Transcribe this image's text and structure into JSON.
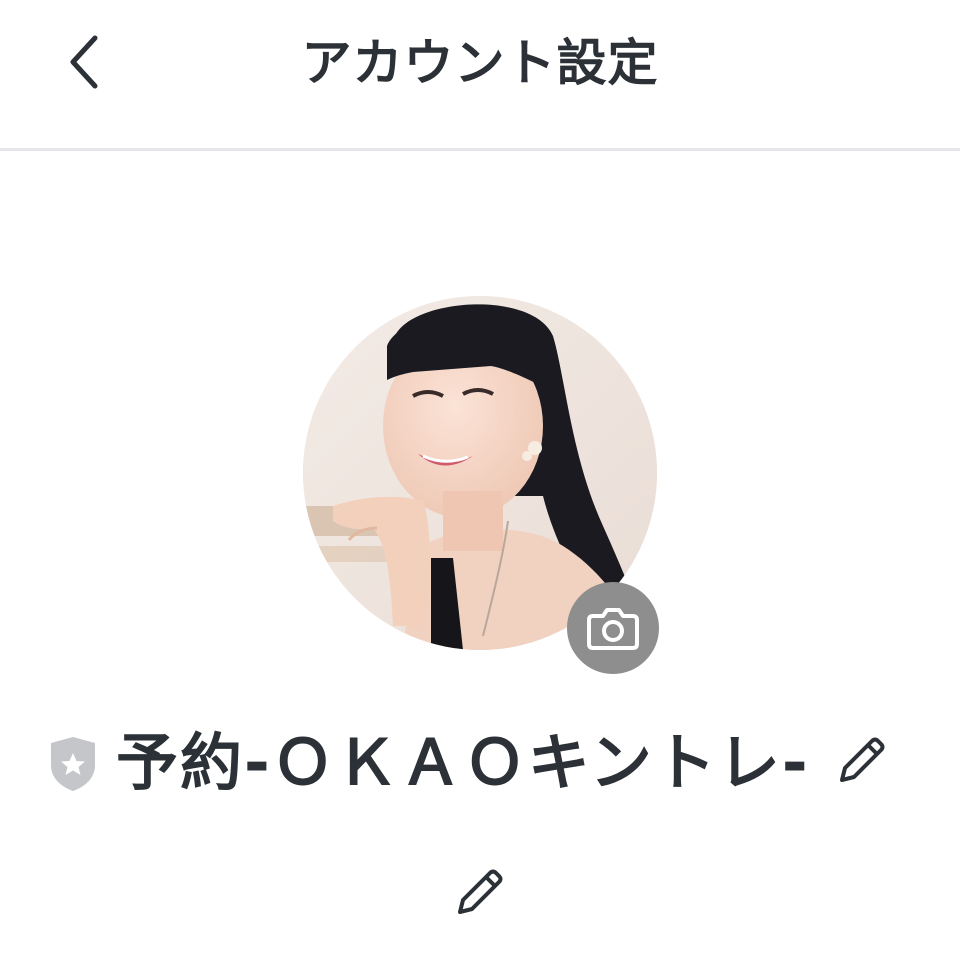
{
  "header": {
    "title": "アカウント設定",
    "back_icon": "chevron-left-icon"
  },
  "profile": {
    "avatar_alt": "profile photo",
    "camera_icon": "camera-icon",
    "badge_icon": "shield-star-icon",
    "name": "予約-ＯＫＡＯキントレ-",
    "edit_name_icon": "pencil-icon",
    "edit_status_icon": "pencil-icon"
  },
  "colors": {
    "text": "#2b3137",
    "divider": "#e6e6ea",
    "camera_bg": "#8e8e8e",
    "badge": "#c4c6ca"
  }
}
